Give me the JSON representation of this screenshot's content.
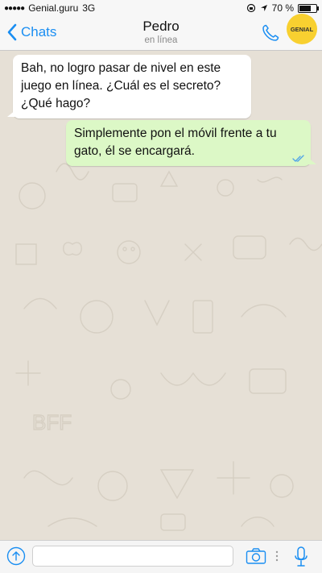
{
  "status_bar": {
    "signal": "●●●●●",
    "carrier": "Genial.guru",
    "network": "3G",
    "battery_percent_label": "70 %",
    "battery_level": 0.7
  },
  "nav": {
    "back_label": "Chats",
    "contact_name": "Pedro",
    "contact_status": "en línea",
    "avatar_text": "GENIAL"
  },
  "messages": [
    {
      "direction": "incoming",
      "text": "Bah, no logro pasar de nivel en este juego en línea. ¿Cuál es el secreto? ¿Qué hago?"
    },
    {
      "direction": "outgoing",
      "text": "Simplemente pon el móvil frente a tu gato, él se encargará.",
      "status": "read"
    }
  ],
  "input_bar": {
    "message_value": "",
    "message_placeholder": ""
  },
  "colors": {
    "accent": "#1a8ef2",
    "chat_background": "#e6e0d6",
    "outgoing_bubble": "#dcf8c6",
    "incoming_bubble": "#ffffff",
    "avatar": "#f8d030"
  }
}
